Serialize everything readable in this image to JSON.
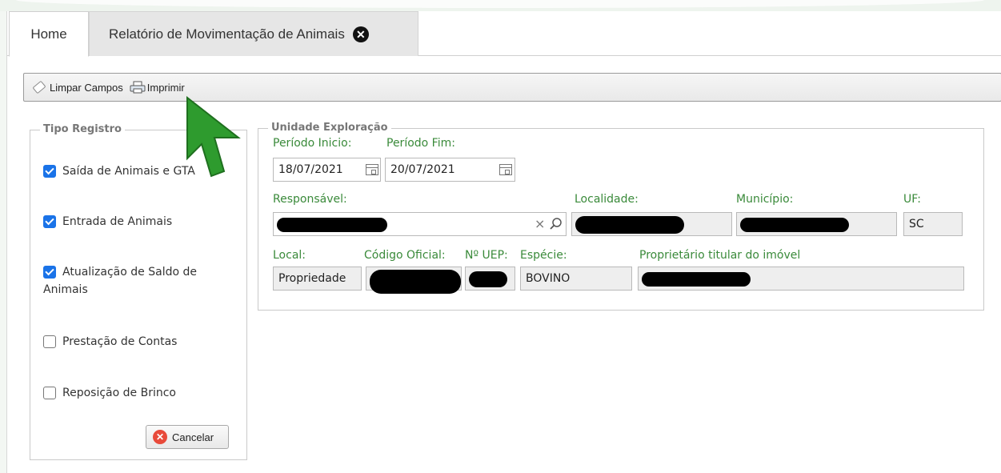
{
  "tabs": [
    {
      "label": "Home"
    },
    {
      "label": "Relatório de Movimentação de Animais"
    }
  ],
  "toolbar": {
    "clear_label": "Limpar Campos",
    "print_label": "Imprimir"
  },
  "tipo_registro": {
    "legend": "Tipo Registro",
    "options": [
      {
        "label": "Saída de Animais e GTA",
        "checked": true
      },
      {
        "label": "Entrada de Animais",
        "checked": true
      },
      {
        "label": "Atualização de Saldo de Animais",
        "checked": true
      },
      {
        "label": "Prestação de Contas",
        "checked": false
      },
      {
        "label": "Reposição de Brinco",
        "checked": false
      }
    ],
    "cancel_label": "Cancelar"
  },
  "unidade": {
    "legend": "Unidade Exploração",
    "periodo_inicio_label": "Período Inicio:",
    "periodo_inicio_value": "18/07/2021",
    "periodo_fim_label": "Período Fim:",
    "periodo_fim_value": "20/07/2021",
    "responsavel_label": "Responsável:",
    "localidade_label": "Localidade:",
    "municipio_label": "Município:",
    "uf_label": "UF:",
    "uf_value": "SC",
    "local_label": "Local:",
    "local_value": "Propriedade",
    "codigo_label": "Código Oficial:",
    "uep_label": "Nº UEP:",
    "especie_label": "Espécie:",
    "especie_value": "BOVINO",
    "proprietario_label": "Proprietário titular do imóvel"
  },
  "colors": {
    "label_green": "#3a8a3a",
    "checkbox_blue": "#1a73e8",
    "cursor_green": "#2e9b2e"
  }
}
